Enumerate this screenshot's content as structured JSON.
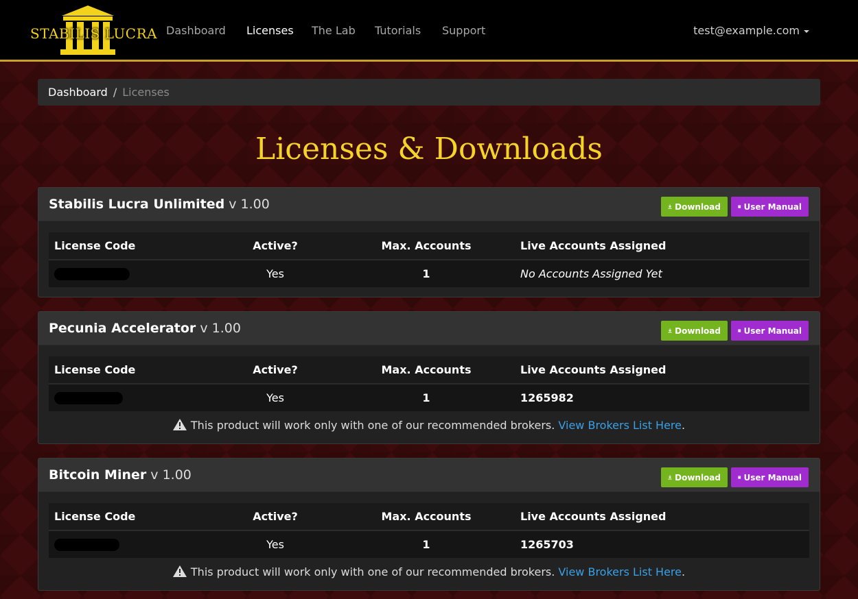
{
  "brand": {
    "name": "STABILIS LUCRA",
    "gold": "#f2d21b"
  },
  "nav": {
    "links": [
      {
        "label": "Dashboard",
        "active": false
      },
      {
        "label": "Licenses",
        "active": true
      },
      {
        "label": "The Lab",
        "active": false
      },
      {
        "label": "Tutorials",
        "active": false
      },
      {
        "label": "Support",
        "active": false
      }
    ],
    "user": "test@example.com"
  },
  "breadcrumb": {
    "root": "Dashboard",
    "separator": "/",
    "current": "Licenses"
  },
  "page_title": "Licenses & Downloads",
  "columns": {
    "code": "License Code",
    "active": "Active?",
    "max": "Max. Accounts",
    "live": "Live Accounts Assigned"
  },
  "buttons": {
    "download": "Download",
    "manual": "User Manual"
  },
  "note": {
    "text": "This product will work only with one of our recommended brokers.",
    "link": "View Brokers List Here",
    "trail": "."
  },
  "products": [
    {
      "name": "Stabilis Lucra Unlimited",
      "version": "v 1.00",
      "active": "Yes",
      "max_accounts": "1",
      "live_accounts": "No Accounts Assigned Yet"
    },
    {
      "name": "Pecunia Accelerator",
      "version": "v 1.00",
      "active": "Yes",
      "max_accounts": "1",
      "live_accounts": "1265982"
    },
    {
      "name": "Bitcoin Miner",
      "version": "v 1.00",
      "active": "Yes",
      "max_accounts": "1",
      "live_accounts": "1265703"
    }
  ],
  "colors": {
    "download": "#74b41e",
    "manual": "#a02cd0",
    "link": "#3aa0e6",
    "accent": "#c9a227"
  }
}
